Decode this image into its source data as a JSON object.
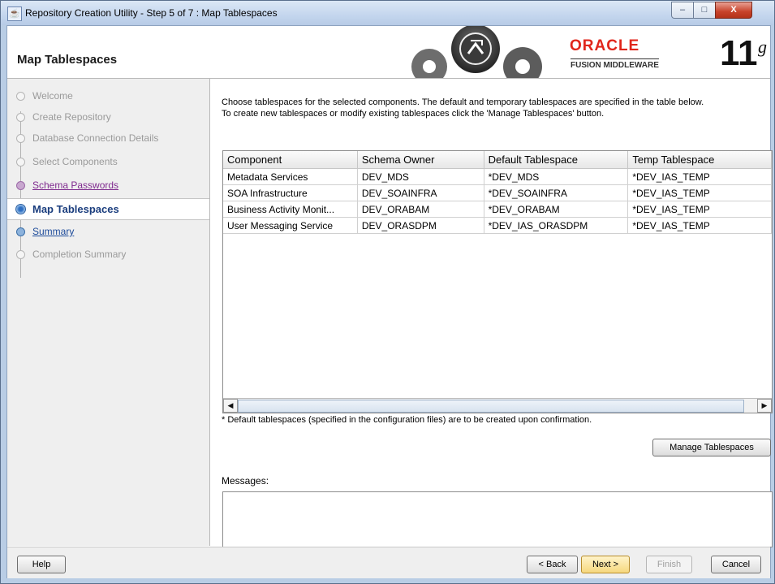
{
  "window": {
    "title": "Repository Creation Utility - Step 5 of 7 : Map Tablespaces",
    "minimize": "–",
    "maximize": "□",
    "close": "X"
  },
  "header": {
    "title": "Map Tablespaces",
    "brand": "ORACLE",
    "subbrand": "FUSION MIDDLEWARE",
    "version": "11",
    "version_suffix": "g"
  },
  "nav": {
    "items": [
      {
        "label": "Welcome",
        "state": "disabled"
      },
      {
        "label": "Create Repository",
        "state": "disabled"
      },
      {
        "label": "Database Connection Details",
        "state": "disabled"
      },
      {
        "label": "Select Components",
        "state": "disabled"
      },
      {
        "label": "Schema Passwords",
        "state": "visited"
      },
      {
        "label": "Map Tablespaces",
        "state": "current"
      },
      {
        "label": "Summary",
        "state": "link"
      },
      {
        "label": "Completion Summary",
        "state": "disabled"
      }
    ]
  },
  "instructions": {
    "line1": "Choose tablespaces for the selected components. The default and temporary tablespaces are specified in the table below.",
    "line2": "To create new tablespaces or modify existing tablespaces click the 'Manage Tablespaces' button."
  },
  "table": {
    "columns": [
      "Component",
      "Schema Owner",
      "Default Tablespace",
      "Temp Tablespace"
    ],
    "rows": [
      [
        "Metadata Services",
        "DEV_MDS",
        "*DEV_MDS",
        "*DEV_IAS_TEMP"
      ],
      [
        "SOA Infrastructure",
        "DEV_SOAINFRA",
        "*DEV_SOAINFRA",
        "*DEV_IAS_TEMP"
      ],
      [
        "Business Activity Monit...",
        "DEV_ORABAM",
        "*DEV_ORABAM",
        "*DEV_IAS_TEMP"
      ],
      [
        "User Messaging Service",
        "DEV_ORASDPM",
        "*DEV_IAS_ORASDPM",
        "*DEV_IAS_TEMP"
      ]
    ]
  },
  "note": "* Default tablespaces (specified in the configuration files) are to be created upon confirmation.",
  "buttons": {
    "manage": "Manage Tablespaces",
    "help": "Help",
    "back": "< Back",
    "next": "Next >",
    "finish": "Finish",
    "cancel": "Cancel"
  },
  "messages": {
    "label": "Messages:",
    "value": ""
  },
  "colors": {
    "oracle_red": "#e0261b",
    "current_step": "#1b3e7e",
    "visited_link": "#7f2a8e",
    "link": "#1d4b9a"
  }
}
